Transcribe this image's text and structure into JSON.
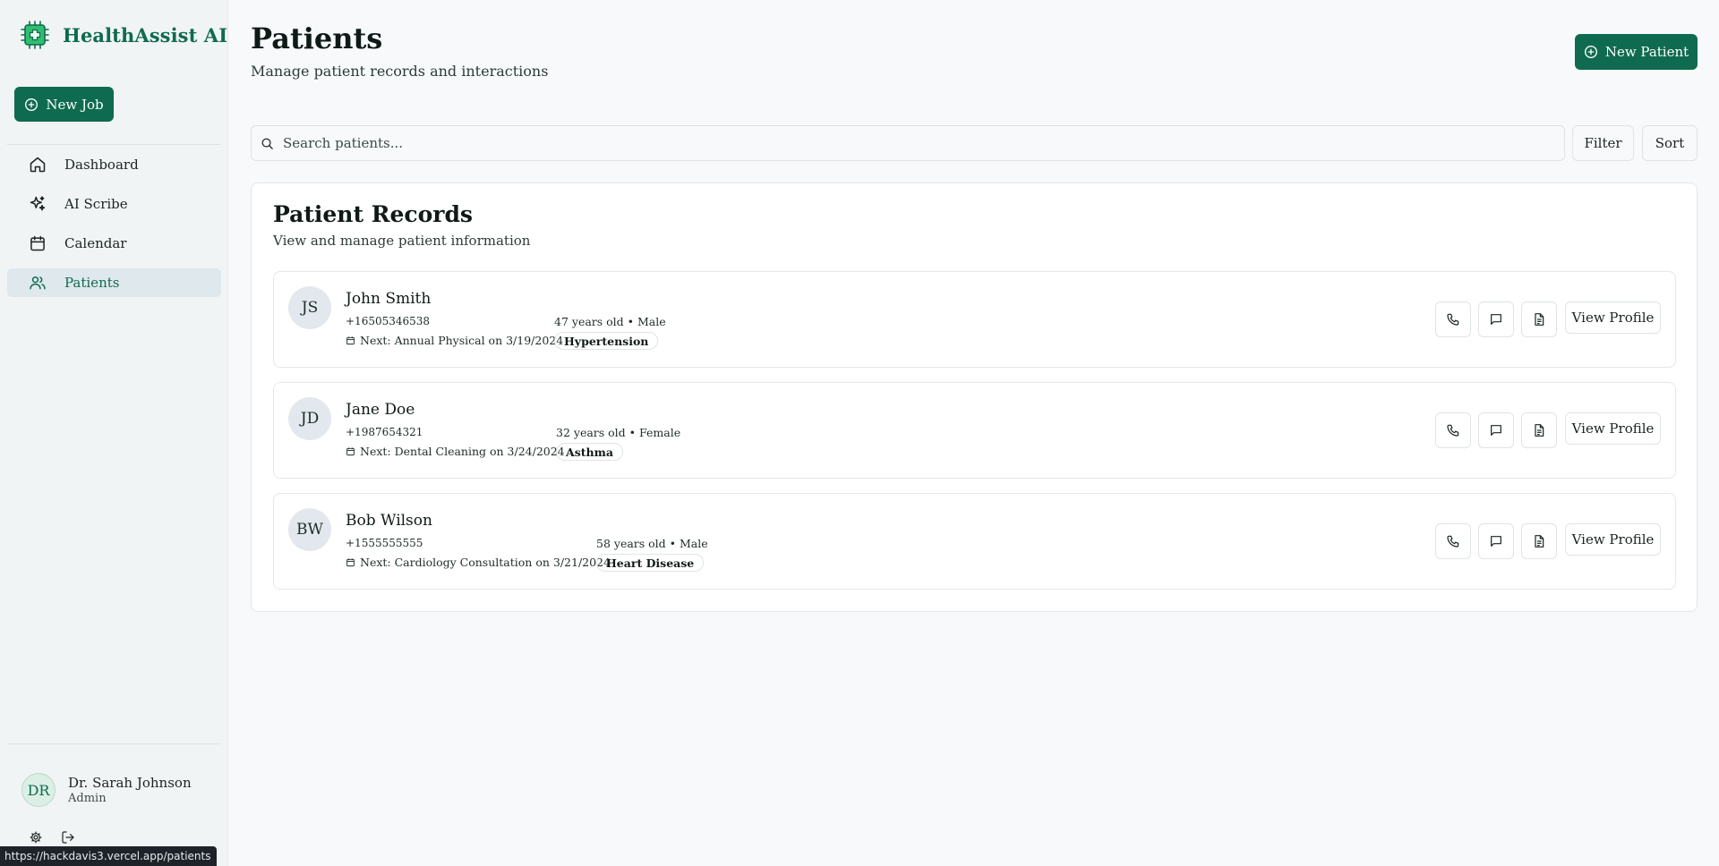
{
  "brand": {
    "name": "HealthAssist AI",
    "logo_icon": "medical-chip-icon",
    "color": "#0f6b4f"
  },
  "sidebar": {
    "new_job_label": "New Job",
    "items": [
      {
        "label": "Dashboard",
        "icon": "home-icon",
        "active": false
      },
      {
        "label": "AI Scribe",
        "icon": "sparkles-icon",
        "active": false
      },
      {
        "label": "Calendar",
        "icon": "calendar-icon",
        "active": false
      },
      {
        "label": "Patients",
        "icon": "users-icon",
        "active": true
      }
    ],
    "user": {
      "initials": "DR",
      "name": "Dr. Sarah Johnson",
      "role": "Admin"
    }
  },
  "status_url": "https://hackdavis3.vercel.app/patients",
  "main": {
    "title": "Patients",
    "subtitle": "Manage patient records and interactions",
    "new_patient_label": "New Patient",
    "search_placeholder": "Search patients...",
    "filter_label": "Filter",
    "sort_label": "Sort"
  },
  "records": {
    "title": "Patient Records",
    "subtitle": "View and manage patient information",
    "view_profile_label": "View Profile",
    "patients": [
      {
        "initials": "JS",
        "name": "John Smith",
        "phone": "+16505346538",
        "demographics": "47 years old • Male",
        "next": "Next: Annual Physical on 3/19/2024",
        "condition": "Hypertension"
      },
      {
        "initials": "JD",
        "name": "Jane Doe",
        "phone": "+1987654321",
        "demographics": "32 years old • Female",
        "next": "Next: Dental Cleaning on 3/24/2024",
        "condition": "Asthma"
      },
      {
        "initials": "BW",
        "name": "Bob Wilson",
        "phone": "+1555555555",
        "demographics": "58 years old • Male",
        "next": "Next: Cardiology Consultation on 3/21/2024",
        "condition": "Heart Disease"
      }
    ]
  }
}
